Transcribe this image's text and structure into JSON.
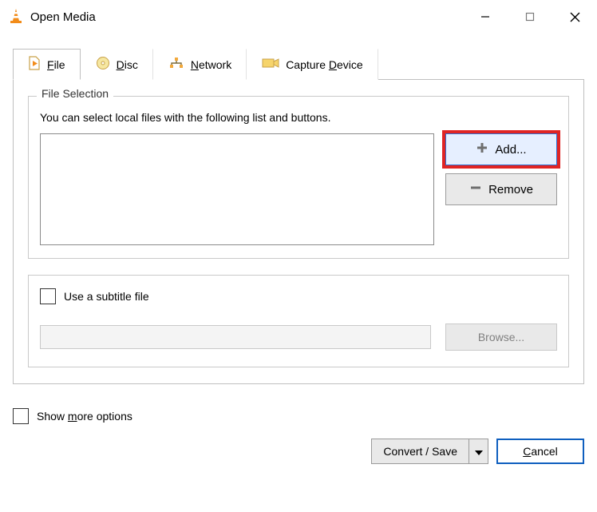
{
  "window": {
    "title": "Open Media"
  },
  "tabs": {
    "file": "File",
    "disc": "Disc",
    "network": "Network",
    "capture": "Capture Device"
  },
  "fileSelection": {
    "legend": "File Selection",
    "instruction": "You can select local files with the following list and buttons.",
    "add": "Add...",
    "remove": "Remove"
  },
  "subtitle": {
    "checkbox": "Use a subtitle file",
    "browse": "Browse..."
  },
  "options": {
    "showMore": "Show more options"
  },
  "actions": {
    "convert": "Convert / Save",
    "cancel": "Cancel"
  }
}
